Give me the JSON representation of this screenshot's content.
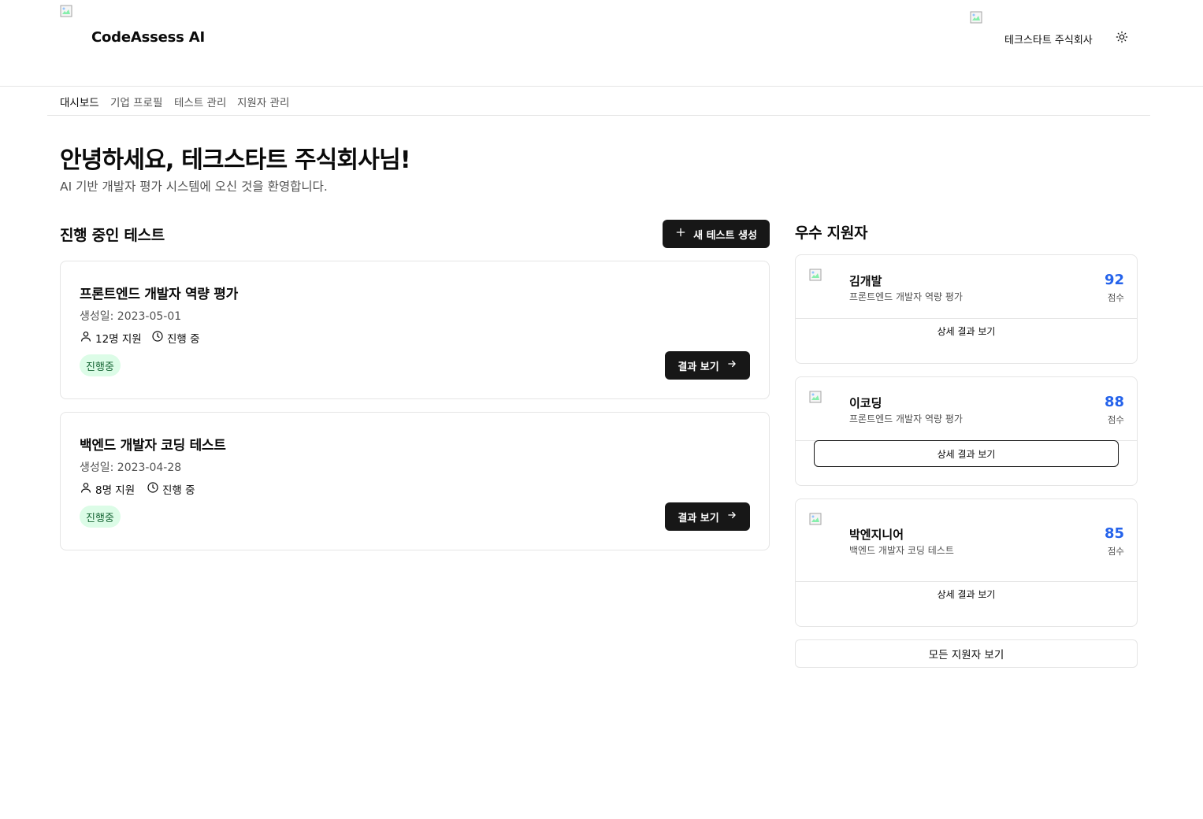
{
  "header": {
    "brand": "CodeAssess AI",
    "company_name": "테크스타트 주식회사",
    "logo_icon": "broken-image-icon",
    "theme_icon": "sun-icon"
  },
  "nav": {
    "items": [
      {
        "label": "대시보드",
        "active": true
      },
      {
        "label": "기업 프로필",
        "active": false
      },
      {
        "label": "테스트 관리",
        "active": false
      },
      {
        "label": "지원자 관리",
        "active": false
      }
    ]
  },
  "welcome": {
    "title": "안녕하세요, 테크스타트 주식회사님!",
    "subtitle": "AI 기반 개발자 평가 시스템에 오신 것을 환영합니다."
  },
  "tests": {
    "section_title": "진행 중인 테스트",
    "new_button_label": "새 테스트 생성",
    "items": [
      {
        "title": "프론트엔드 개발자 역량 평가",
        "created": "생성일: 2023-05-01",
        "applicants": "12명 지원",
        "status_text": "진행 중",
        "badge": "진행중",
        "button_label": "결과 보기"
      },
      {
        "title": "백엔드 개발자 코딩 테스트",
        "created": "생성일: 2023-04-28",
        "applicants": "8명 지원",
        "status_text": "진행 중",
        "badge": "진행중",
        "button_label": "결과 보기"
      }
    ]
  },
  "candidates": {
    "section_title": "우수 지원자",
    "score_label": "점수",
    "detail_label": "상세 결과 보기",
    "all_button_label": "모든 지원자 보기",
    "items": [
      {
        "name": "김개발",
        "test": "프론트엔드 개발자 역량 평가",
        "score": "92"
      },
      {
        "name": "이코딩",
        "test": "프론트엔드 개발자 역량 평가",
        "score": "88"
      },
      {
        "name": "박엔지니어",
        "test": "백엔드 개발자 코딩 테스트",
        "score": "85"
      }
    ]
  },
  "colors": {
    "primary": "#171717",
    "score": "#2563eb",
    "badge_bg": "#dcfce7",
    "badge_text": "#166534",
    "border": "#e5e5e5"
  }
}
